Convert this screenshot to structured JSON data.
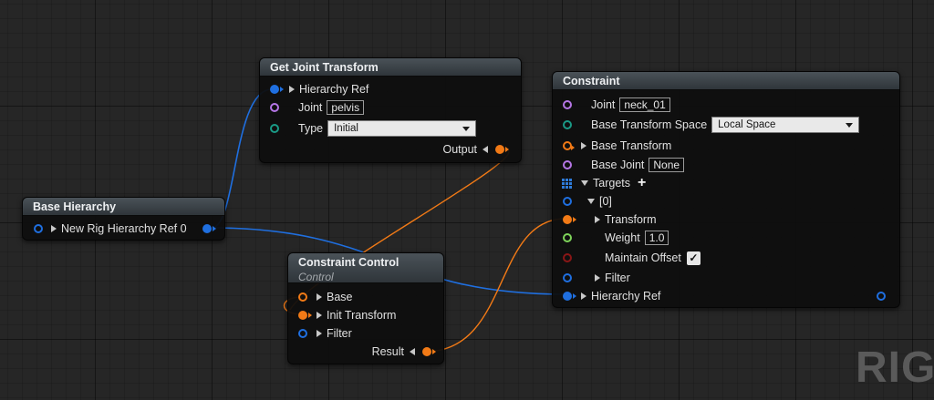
{
  "colors": {
    "execution_blue": "#1f6fe0",
    "transform_orange": "#f27a16",
    "name_purple": "#b576e6",
    "enum_teal": "#1a9a86",
    "float_green": "#7ed35a",
    "bool_red": "#8a1616"
  },
  "nodes": {
    "base_hierarchy": {
      "title": "Base Hierarchy",
      "pins": {
        "new_ref": "New Rig Hierarchy Ref 0"
      }
    },
    "get_joint_transform": {
      "title": "Get Joint Transform",
      "pins": {
        "hierarchy_ref": "Hierarchy Ref",
        "joint_label": "Joint",
        "joint_value": "pelvis",
        "type_label": "Type",
        "type_value": "Initial",
        "output": "Output"
      }
    },
    "constraint_control": {
      "title": "Constraint Control",
      "subtitle": "Control",
      "pins": {
        "base": "Base",
        "init_transform": "Init Transform",
        "filter": "Filter",
        "result": "Result"
      }
    },
    "constraint": {
      "title": "Constraint",
      "pins": {
        "joint_label": "Joint",
        "joint_value": "neck_01",
        "base_space_label": "Base Transform Space",
        "base_space_value": "Local Space",
        "base_transform": "Base Transform",
        "base_joint_label": "Base Joint",
        "base_joint_value": "None",
        "targets": "Targets",
        "index0": "[0]",
        "transform": "Transform",
        "weight_label": "Weight",
        "weight_value": "1.0",
        "maintain_offset": "Maintain Offset",
        "filter": "Filter",
        "hierarchy_ref": "Hierarchy Ref"
      }
    }
  },
  "watermark": "RIG"
}
